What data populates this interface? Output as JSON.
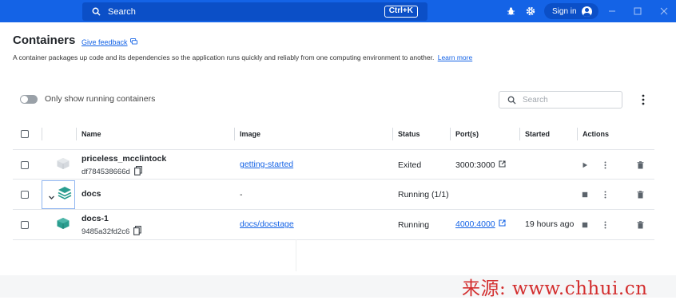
{
  "topbar": {
    "search_placeholder": "Search",
    "shortcut": "Ctrl+K",
    "sign_in": "Sign in"
  },
  "page": {
    "title": "Containers",
    "feedback": "Give feedback",
    "description": "A container packages up code and its dependencies so the application runs quickly and reliably from one computing environment to another.",
    "learn_more": "Learn more",
    "toggle_label": "Only show running containers",
    "search_placeholder": "Search"
  },
  "table": {
    "headers": {
      "name": "Name",
      "image": "Image",
      "status": "Status",
      "ports": "Port(s)",
      "started": "Started",
      "actions": "Actions"
    },
    "rows": [
      {
        "name": "priceless_mcclintock",
        "id": "df784538666d",
        "image": "getting-started",
        "status": "Exited",
        "ports": "3000:3000",
        "started": ""
      },
      {
        "name": "docs",
        "id": "",
        "image": "-",
        "status": "Running (1/1)",
        "ports": "",
        "started": ""
      },
      {
        "name": "docs-1",
        "id": "9485a32fd2c6",
        "image": "docs/docstage",
        "status": "Running",
        "ports": "4000:4000",
        "started": "19 hours ago"
      }
    ]
  },
  "watermark": "来源:  www.chhui.cn",
  "colors": {
    "accent": "#1463e6",
    "topbar": "#1463e6",
    "container_icon": "#2a9d8f"
  }
}
